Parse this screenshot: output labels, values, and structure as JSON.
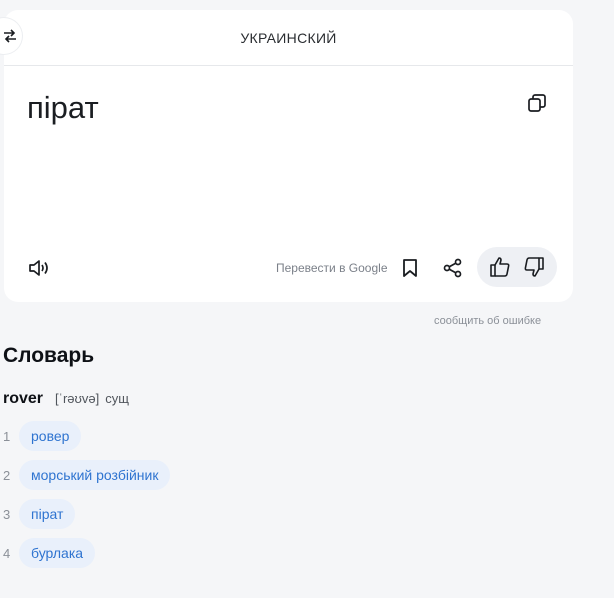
{
  "header": {
    "target_language": "УКРАИНСКИЙ"
  },
  "translation": {
    "text": "пірат"
  },
  "actions": {
    "google_link": "Перевести в Google",
    "report_error": "сообщить об ошибке"
  },
  "dictionary": {
    "title": "Словарь",
    "entry": {
      "word": "rover",
      "transcription": "[ˈrəʊvə]",
      "part_of_speech": "сущ"
    },
    "meanings": [
      {
        "num": "1",
        "text": "ровер"
      },
      {
        "num": "2",
        "text": "морський розбійник"
      },
      {
        "num": "3",
        "text": "пірат"
      },
      {
        "num": "4",
        "text": "бурлака"
      }
    ]
  },
  "icons": {
    "swap": "swap-arrows-icon",
    "copy": "copy-icon",
    "speak": "speaker-icon",
    "bookmark": "bookmark-icon",
    "share": "share-icon",
    "like": "thumbs-up-icon",
    "dislike": "thumbs-down-icon"
  },
  "colors": {
    "chip_bg": "#e9f0fb",
    "chip_text": "#2f74d0",
    "page_bg": "#f5f6f8"
  }
}
